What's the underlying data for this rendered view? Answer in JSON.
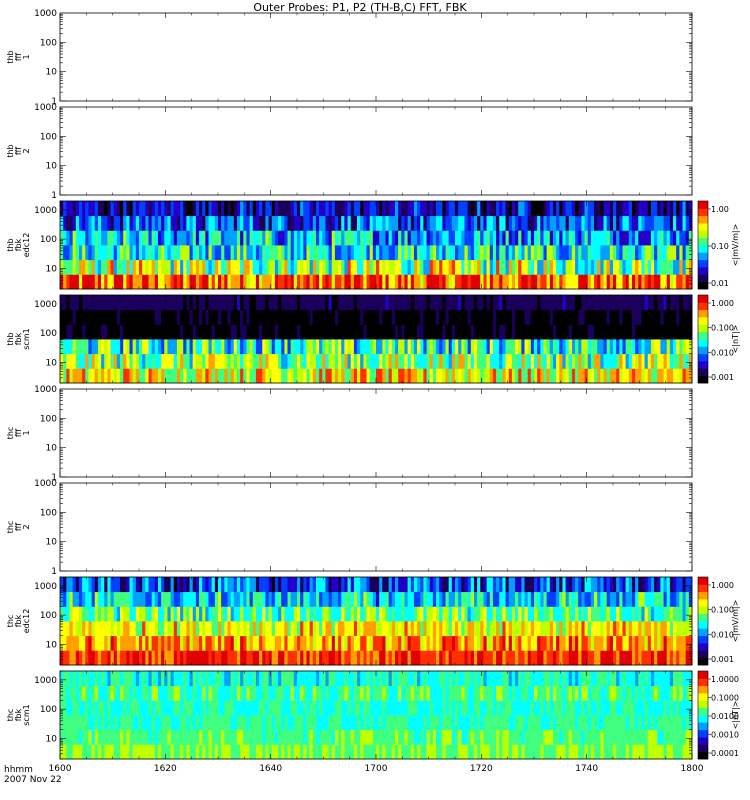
{
  "title": "Outer Probes: P1, P2 (TH-B,C) FFT, FBK",
  "time_axis": {
    "ticks": [
      "1600",
      "1620",
      "1640",
      "1700",
      "1720",
      "1740",
      "1800"
    ],
    "corner_label_1": "hhmm",
    "corner_label_2": "2007 Nov 22"
  },
  "colors": {
    "spectrogram_scale": [
      "#000000",
      "#1a005a",
      "#2200c8",
      "#0040ff",
      "#00a0ff",
      "#00ffff",
      "#40ff80",
      "#c0ff00",
      "#ffff00",
      "#ffa000",
      "#ff3000",
      "#e00000"
    ]
  },
  "chart_data": [
    {
      "type": "heatmap",
      "panel": "thb-fff-1",
      "ylabel": [
        "thb",
        "fff",
        "1"
      ],
      "y_scale": "log",
      "ylim": [
        1,
        1000
      ],
      "yticks": [
        "1",
        "10",
        "100",
        "1000"
      ],
      "has_data": false
    },
    {
      "type": "heatmap",
      "panel": "thb-fff-2",
      "ylabel": [
        "thb",
        "fff",
        "2"
      ],
      "y_scale": "log",
      "ylim": [
        1,
        1000
      ],
      "yticks": [
        "1",
        "10",
        "100",
        "1000"
      ],
      "has_data": false
    },
    {
      "type": "heatmap",
      "panel": "thb-fbk-edc12",
      "ylabel": [
        "thb",
        "fbk",
        "edc12"
      ],
      "y_scale": "log",
      "ylim": [
        2,
        2000
      ],
      "yticks": [
        "10",
        "100",
        "1000"
      ],
      "has_data": true,
      "bands": [
        {
          "name": "b1",
          "mean": 0.85,
          "spread": 0.22
        },
        {
          "name": "b2",
          "mean": 0.6,
          "spread": 0.25
        },
        {
          "name": "b3",
          "mean": 0.45,
          "spread": 0.2
        },
        {
          "name": "b4",
          "mean": 0.4,
          "spread": 0.2
        },
        {
          "name": "b5",
          "mean": 0.3,
          "spread": 0.2
        },
        {
          "name": "b6",
          "mean": 0.2,
          "spread": 0.15
        }
      ],
      "colorbar": {
        "label": "<|mV/m|>",
        "scale": "log",
        "ticks": [
          "1.00",
          "0.10",
          "0.01"
        ]
      }
    },
    {
      "type": "heatmap",
      "panel": "thb-fbk-scm1",
      "ylabel": [
        "thb",
        "fbk",
        "scm1"
      ],
      "y_scale": "log",
      "ylim": [
        2,
        2000
      ],
      "yticks": [
        "10",
        "100",
        "1000"
      ],
      "has_data": true,
      "bands": [
        {
          "name": "b1",
          "mean": 0.7,
          "spread": 0.2
        },
        {
          "name": "b2",
          "mean": 0.6,
          "spread": 0.22
        },
        {
          "name": "b3",
          "mean": 0.5,
          "spread": 0.22
        },
        {
          "name": "b4",
          "mean": 0.05,
          "spread": 0.05
        },
        {
          "name": "b5",
          "mean": 0.05,
          "spread": 0.05
        },
        {
          "name": "b6",
          "mean": 0.12,
          "spread": 0.05
        }
      ],
      "colorbar": {
        "label": "<|nT|>",
        "scale": "log",
        "ticks": [
          "1.000",
          "0.100",
          "0.010",
          "0.001"
        ]
      }
    },
    {
      "type": "heatmap",
      "panel": "thc-fff-1",
      "ylabel": [
        "thc",
        "fff",
        "1"
      ],
      "y_scale": "log",
      "ylim": [
        1,
        1000
      ],
      "yticks": [
        "1",
        "10",
        "100",
        "1000"
      ],
      "has_data": false
    },
    {
      "type": "heatmap",
      "panel": "thc-fff-2",
      "ylabel": [
        "thc",
        "fff",
        "2"
      ],
      "y_scale": "log",
      "ylim": [
        1,
        1000
      ],
      "yticks": [
        "1",
        "10",
        "100",
        "1000"
      ],
      "has_data": false
    },
    {
      "type": "heatmap",
      "panel": "thc-fbk-edc12",
      "ylabel": [
        "thc",
        "fbk",
        "edc12"
      ],
      "y_scale": "log",
      "ylim": [
        2,
        2000
      ],
      "yticks": [
        "10",
        "100",
        "1000"
      ],
      "has_data": true,
      "bands": [
        {
          "name": "b1",
          "mean": 0.88,
          "spread": 0.12
        },
        {
          "name": "b2",
          "mean": 0.78,
          "spread": 0.15
        },
        {
          "name": "b3",
          "mean": 0.7,
          "spread": 0.15
        },
        {
          "name": "b4",
          "mean": 0.55,
          "spread": 0.15
        },
        {
          "name": "b5",
          "mean": 0.42,
          "spread": 0.18
        },
        {
          "name": "b6",
          "mean": 0.28,
          "spread": 0.2
        }
      ],
      "colorbar": {
        "label": "<|mV/m|>",
        "scale": "log",
        "ticks": [
          "1.000",
          "0.100",
          "0.010",
          "0.001"
        ]
      }
    },
    {
      "type": "heatmap",
      "panel": "thc-fbk-scm1",
      "ylabel": [
        "thc",
        "fbk",
        "scm1"
      ],
      "y_scale": "log",
      "ylim": [
        2,
        2000
      ],
      "yticks": [
        "10",
        "100",
        "1000"
      ],
      "has_data": true,
      "bands": [
        {
          "name": "b1",
          "mean": 0.58,
          "spread": 0.08
        },
        {
          "name": "b2",
          "mean": 0.55,
          "spread": 0.06
        },
        {
          "name": "b3",
          "mean": 0.52,
          "spread": 0.06
        },
        {
          "name": "b4",
          "mean": 0.5,
          "spread": 0.06
        },
        {
          "name": "b5",
          "mean": 0.52,
          "spread": 0.1
        },
        {
          "name": "b6",
          "mean": 0.48,
          "spread": 0.08
        }
      ],
      "colorbar": {
        "label": "<|nT|>",
        "scale": "log",
        "ticks": [
          "1.0000",
          "0.1000",
          "0.0100",
          "0.0010",
          "0.0001"
        ]
      }
    }
  ]
}
